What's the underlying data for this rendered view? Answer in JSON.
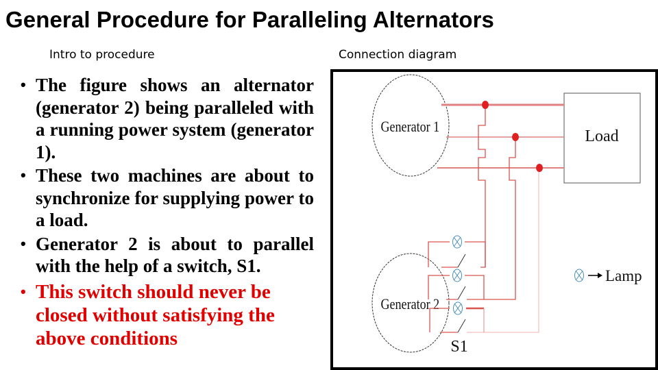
{
  "slide": {
    "title": "General Procedure for Paralleling Alternators",
    "left_heading": "Intro to procedure",
    "right_heading": "Connection diagram",
    "bullets": [
      {
        "text": "The figure  shows an alternator (generator 2) being paralleled with a running power system (generator 1).",
        "emphasis": false
      },
      {
        "text": "These two machines are about to synchronize for supplying power to a load.",
        "emphasis": false
      },
      {
        "text": "Generator 2 is about to parallel with the help of a switch, S1.",
        "emphasis": false
      },
      {
        "text": "This switch should never be closed without satisfying the above conditions",
        "emphasis": true
      }
    ],
    "bullet_glyph": "•",
    "colors": {
      "text": "#000000",
      "warning_text": "#e00000",
      "wire": "#d9534f",
      "junction": "#e02020",
      "lamp": "#4a90b8"
    }
  },
  "diagram": {
    "generator1_label": "Generator 1",
    "generator2_label": "Generator 2",
    "load_label": "Load",
    "switch_label": "S1",
    "legend_lamp_label": "Lamp",
    "icons": [
      "generator-icon",
      "load-box",
      "lamp-icon",
      "switch-icon",
      "junction-dot",
      "arrow-right-icon"
    ]
  }
}
